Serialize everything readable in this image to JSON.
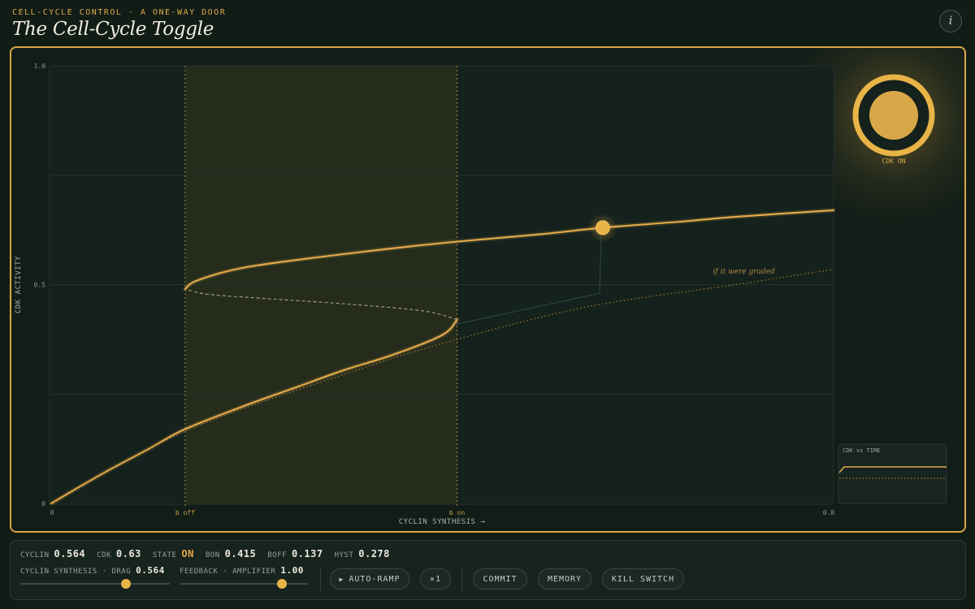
{
  "header": {
    "eyebrow": "CELL-CYCLE CONTROL · A ONE-WAY DOOR",
    "title": "The Cell-Cycle Toggle",
    "info_label": "i"
  },
  "chart_data": {
    "type": "line",
    "xlabel": "CYCLIN SYNTHESIS →",
    "ylabel": "CDK ACTIVITY",
    "xlim": [
      0,
      0.8
    ],
    "ylim": [
      0,
      1.0
    ],
    "x_ticks": [
      "0",
      "b off",
      "b on",
      "0.8"
    ],
    "y_ticks": [
      "1.0",
      "0.5",
      "0"
    ],
    "b_off": 0.137,
    "b_on": 0.415,
    "annotation": "if it were graded",
    "current_point": {
      "x": 0.564,
      "y": 0.63
    },
    "series": [
      {
        "name": "lower stable",
        "style": "solid",
        "points": [
          [
            0,
            0
          ],
          [
            0.05,
            0.065
          ],
          [
            0.1,
            0.125
          ],
          [
            0.137,
            0.17
          ],
          [
            0.2,
            0.225
          ],
          [
            0.25,
            0.265
          ],
          [
            0.3,
            0.305
          ],
          [
            0.35,
            0.34
          ],
          [
            0.4,
            0.385
          ],
          [
            0.415,
            0.42
          ]
        ]
      },
      {
        "name": "unstable",
        "style": "dashed",
        "points": [
          [
            0.415,
            0.42
          ],
          [
            0.38,
            0.44
          ],
          [
            0.3,
            0.456
          ],
          [
            0.22,
            0.468
          ],
          [
            0.16,
            0.478
          ],
          [
            0.137,
            0.49
          ]
        ]
      },
      {
        "name": "upper stable",
        "style": "solid",
        "points": [
          [
            0.137,
            0.49
          ],
          [
            0.15,
            0.51
          ],
          [
            0.2,
            0.54
          ],
          [
            0.3,
            0.57
          ],
          [
            0.4,
            0.595
          ],
          [
            0.5,
            0.615
          ],
          [
            0.564,
            0.63
          ],
          [
            0.65,
            0.645
          ],
          [
            0.7,
            0.655
          ],
          [
            0.8,
            0.67
          ]
        ]
      },
      {
        "name": "graded",
        "style": "dotted",
        "points": [
          [
            0,
            0
          ],
          [
            0.137,
            0.165
          ],
          [
            0.3,
            0.295
          ],
          [
            0.415,
            0.375
          ],
          [
            0.55,
            0.45
          ],
          [
            0.7,
            0.5
          ],
          [
            0.8,
            0.535
          ]
        ]
      }
    ]
  },
  "indicator": {
    "label": "CDK ON"
  },
  "mini_chart": {
    "title": "CDK vs TIME"
  },
  "readouts": {
    "cyclin_label": "CYCLIN",
    "cyclin_value": "0.564",
    "cdk_label": "CDK",
    "cdk_value": "0.63",
    "state_label": "STATE",
    "state_value": "ON",
    "bon_label": "BON",
    "bon_value": "0.415",
    "boff_label": "BOFF",
    "boff_value": "0.137",
    "hyst_label": "HYST",
    "hyst_value": "0.278"
  },
  "sliders": {
    "synthesis_label": "CYCLIN SYNTHESIS · DRAG",
    "synthesis_value": "0.564",
    "synthesis_fraction": 0.705,
    "feedback_label": "FEEDBACK · AMPLIFIER",
    "feedback_value": "1.00",
    "feedback_fraction": 0.8
  },
  "buttons": {
    "auto_ramp": "AUTO-RAMP",
    "speed": "×1",
    "commit": "COMMIT",
    "memory": "MEMORY",
    "kill_switch": "KILL SWITCH"
  },
  "colors": {
    "accent": "#e8b447",
    "curve": "#e2a84a",
    "background": "#111c17"
  }
}
